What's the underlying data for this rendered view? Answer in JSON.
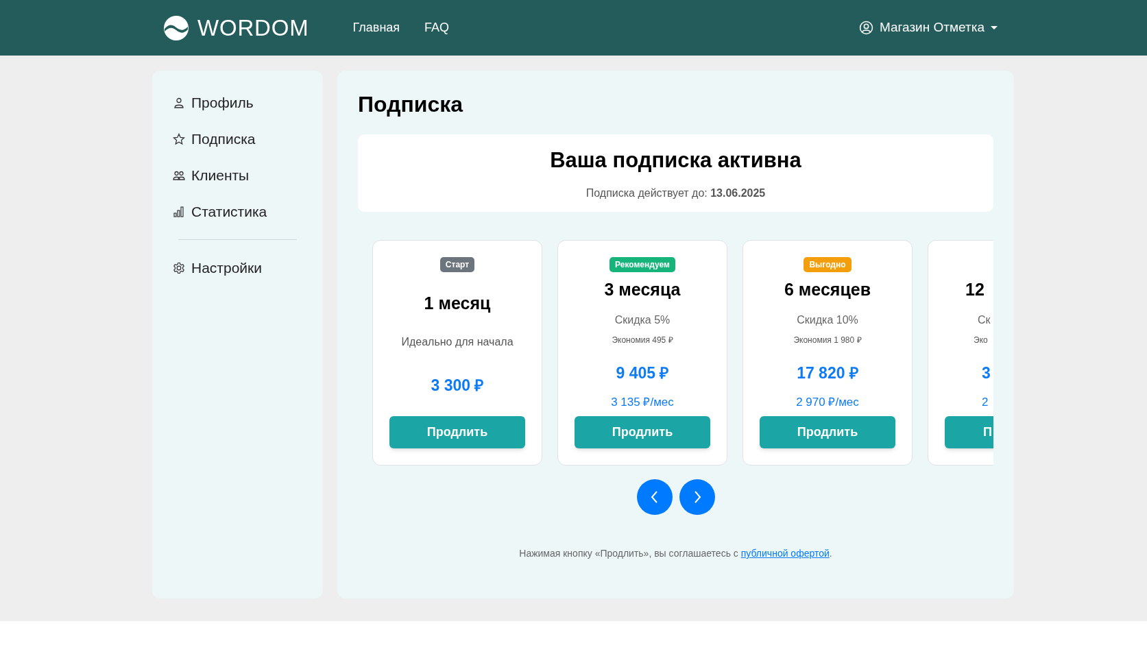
{
  "header": {
    "logo": "WORDOM",
    "nav": [
      {
        "label": "Главная"
      },
      {
        "label": "FAQ"
      }
    ],
    "user_menu": "Магазин Отметка"
  },
  "sidebar": {
    "sections": [
      [
        {
          "label": "Профиль"
        },
        {
          "label": "Подписка"
        },
        {
          "label": "Клиенты"
        },
        {
          "label": "Статистика"
        }
      ],
      [
        {
          "label": "Настройки"
        }
      ]
    ]
  },
  "main": {
    "title": "Подписка",
    "status": {
      "heading": "Ваша подписка активна",
      "text": "Подписка действует до: **13.06.2025**"
    },
    "plans": [
      {
        "kind": "full",
        "badge": {
          "text": "Старт",
          "color": "#6c757d"
        },
        "title": "1 месяц",
        "description": "Идеально для начала",
        "price": "3 300 ₽",
        "button": "Продлить"
      },
      {
        "kind": "full",
        "badge": {
          "text": "Рекомендуем",
          "color": "#16b47a"
        },
        "title": "3 месяца",
        "discount": "Скидка 5%",
        "savings": "Экономия 495 ₽",
        "price": "9 405 ₽",
        "per_month": "3 135 ₽/мес",
        "button": "Продлить"
      },
      {
        "kind": "full",
        "badge": {
          "text": "Выгодно",
          "color": "#f59e0b"
        },
        "title": "6 месяцев",
        "discount": "Скидка 10%",
        "savings": "Экономия 1 980 ₽",
        "price": "17 820 ₽",
        "per_month": "2 970 ₽/мес",
        "button": "Продлить"
      },
      {
        "kind": "partial",
        "title": "12",
        "discount": "Ск",
        "savings": "Эко",
        "price": "3",
        "per_month": "2",
        "button": "П"
      }
    ],
    "note": {
      "before": "Нажимая кнопку «Продлить», вы соглашаетесь с ",
      "link": "публичной офертой",
      "after": "."
    }
  }
}
